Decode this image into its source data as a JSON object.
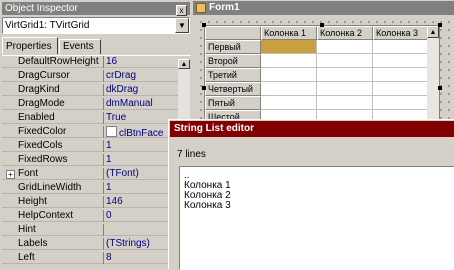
{
  "inspector": {
    "title": "Object Inspector",
    "close_glyph": "x",
    "component": "VirtGrid1: TVirtGrid",
    "tabs": [
      "Properties",
      "Events"
    ],
    "properties": [
      {
        "name": "DefaultRowHeight",
        "value": "16"
      },
      {
        "name": "DragCursor",
        "value": "crDrag"
      },
      {
        "name": "DragKind",
        "value": "dkDrag"
      },
      {
        "name": "DragMode",
        "value": "dmManual"
      },
      {
        "name": "Enabled",
        "value": "True"
      },
      {
        "name": "FixedColor",
        "value": "clBtnFace",
        "swatch": true
      },
      {
        "name": "FixedCols",
        "value": "1"
      },
      {
        "name": "FixedRows",
        "value": "1"
      },
      {
        "name": "Font",
        "value": "(TFont)",
        "expandable": true
      },
      {
        "name": "GridLineWidth",
        "value": "1"
      },
      {
        "name": "Height",
        "value": "146"
      },
      {
        "name": "HelpContext",
        "value": "0"
      },
      {
        "name": "Hint",
        "value": ""
      },
      {
        "name": "Labels",
        "value": "(TStrings)"
      },
      {
        "name": "Left",
        "value": "8"
      }
    ]
  },
  "form": {
    "title": "Form1"
  },
  "grid": {
    "columns": [
      "Колонка 1",
      "Колонка 2",
      "Колонка 3"
    ],
    "rows": [
      "Первый",
      "Второй",
      "Третий",
      "Четвертый",
      "Пятый",
      "Шестой"
    ]
  },
  "editor": {
    "title": "String List editor",
    "line_count": "7 lines",
    "lines": [
      "..",
      "Колонка 1",
      "Колонка 2",
      "Колонка 3"
    ]
  },
  "colors": {
    "selected_cell": "#c8a040",
    "editor_title_bar": "#800000",
    "inactive_title_bar": "#808080"
  }
}
